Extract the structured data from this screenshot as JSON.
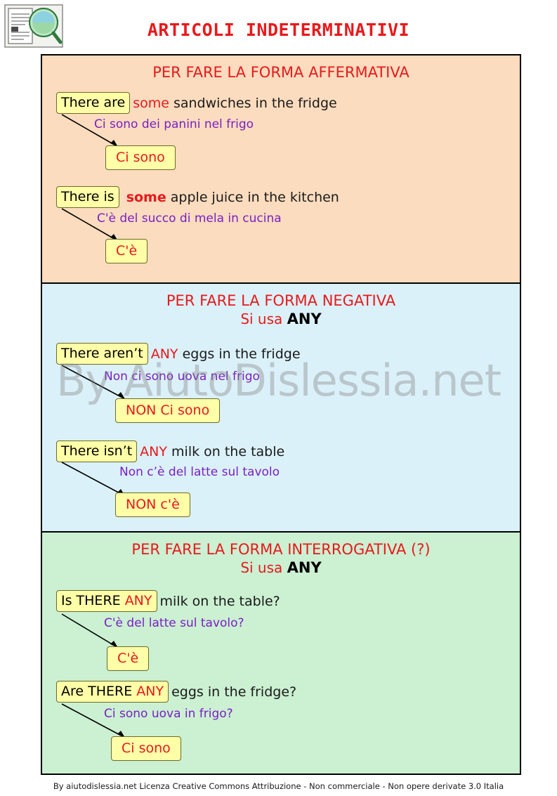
{
  "page_title": "ARTICOLI INDETERMINATIVI",
  "watermark": "By AiutoDislessia.net",
  "footer": "By aiutodislessia.net Licenza Creative Commons Attribuzione - Non commerciale - Non opere derivate 3.0 Italia",
  "colors": {
    "title_red": "#e8191c",
    "purple": "#7a1fc4",
    "chip_yellow": "#ffffa8",
    "affirmative_bg": "#fbdcbe",
    "negative_bg": "#dbf1f9",
    "interrogative_bg": "#cbf0d2"
  },
  "sections": [
    {
      "heading": "PER FARE LA FORMA AFFERMATIVA",
      "subheading": "",
      "subheading_keyword": "",
      "examples": [
        {
          "chip": "There are",
          "keyword": "some",
          "rest": " sandwiches in the fridge",
          "translation": "Ci sono dei panini nel frigo",
          "answer": "Ci sono"
        },
        {
          "chip": "There is",
          "keyword": "some",
          "rest": " apple juice in the kitchen",
          "translation": "C'è del succo di mela in cucina",
          "answer": "C'è"
        }
      ]
    },
    {
      "heading": "PER FARE LA FORMA NEGATIVA",
      "subheading": "Si usa ",
      "subheading_keyword": "ANY",
      "examples": [
        {
          "chip": "There aren’t",
          "keyword": "ANY",
          "rest": " eggs in the fridge",
          "translation": "Non ci sono uova nel frigo",
          "answer": "NON Ci sono"
        },
        {
          "chip": "There isn’t",
          "keyword": "ANY",
          "rest": " milk on the table",
          "translation": "Non c’è del latte sul tavolo",
          "answer": "NON c'è"
        }
      ]
    },
    {
      "heading": "PER FARE LA FORMA INTERROGATIVA (?)",
      "subheading": "Si usa ",
      "subheading_keyword": "ANY",
      "examples": [
        {
          "chip": "Is THERE ",
          "chip_keyword": "ANY",
          "rest": "milk on the table?",
          "translation": "C'è del latte sul tavolo?",
          "answer": "C'è"
        },
        {
          "chip": "Are THERE ",
          "chip_keyword": "ANY",
          "rest": "eggs in the fridge?",
          "translation": "Ci sono uova in frigo?",
          "answer": "Ci sono"
        }
      ]
    }
  ]
}
